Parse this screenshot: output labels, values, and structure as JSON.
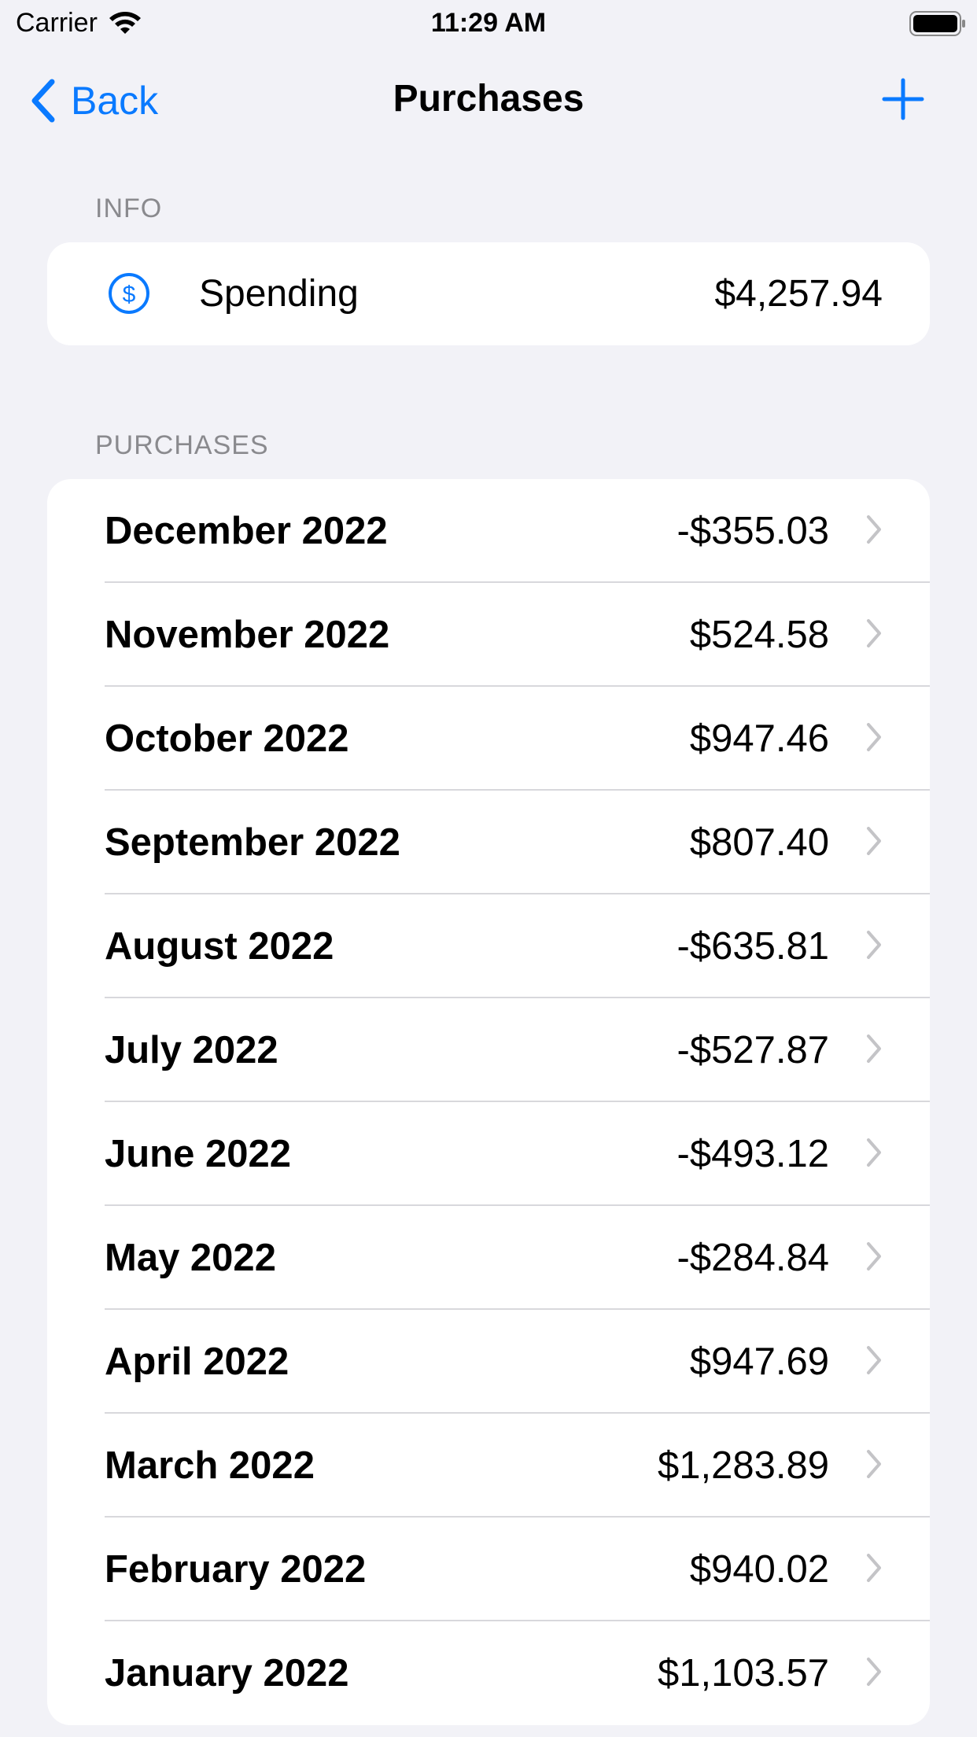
{
  "status_bar": {
    "carrier": "Carrier",
    "time": "11:29 AM"
  },
  "nav": {
    "back_label": "Back",
    "title": "Purchases",
    "add_icon": "plus-icon"
  },
  "info_section": {
    "header": "INFO",
    "label": "Spending",
    "value": "$4,257.94",
    "icon": "dollar-circle-icon"
  },
  "purchases_section": {
    "header": "PURCHASES",
    "items": [
      {
        "month": "December 2022",
        "amount": "-$355.03"
      },
      {
        "month": "November 2022",
        "amount": "$524.58"
      },
      {
        "month": "October 2022",
        "amount": "$947.46"
      },
      {
        "month": "September 2022",
        "amount": "$807.40"
      },
      {
        "month": "August 2022",
        "amount": "-$635.81"
      },
      {
        "month": "July 2022",
        "amount": "-$527.87"
      },
      {
        "month": "June 2022",
        "amount": "-$493.12"
      },
      {
        "month": "May 2022",
        "amount": "-$284.84"
      },
      {
        "month": "April 2022",
        "amount": "$947.69"
      },
      {
        "month": "March 2022",
        "amount": "$1,283.89"
      },
      {
        "month": "February 2022",
        "amount": "$940.02"
      },
      {
        "month": "January 2022",
        "amount": "$1,103.57"
      }
    ]
  },
  "colors": {
    "accent": "#0a7aff",
    "background": "#f2f2f7",
    "secondary_text": "#8a8a8e",
    "chevron": "#c4c4c7"
  }
}
